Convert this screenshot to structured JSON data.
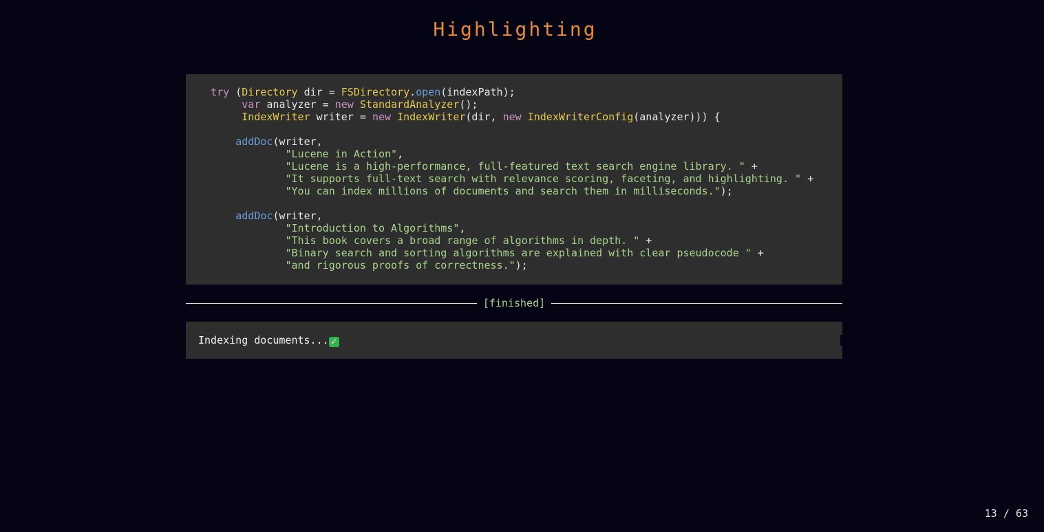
{
  "slide": {
    "title": "Highlighting",
    "page_indicator": "13 / 63"
  },
  "code": {
    "lines": [
      [
        {
          "t": "    ",
          "c": "pl"
        },
        {
          "t": "try",
          "c": "kw"
        },
        {
          "t": " (",
          "c": "pl"
        },
        {
          "t": "Directory",
          "c": "ty"
        },
        {
          "t": " dir = ",
          "c": "pl"
        },
        {
          "t": "FSDirectory",
          "c": "ty"
        },
        {
          "t": ".",
          "c": "pl"
        },
        {
          "t": "open",
          "c": "fn"
        },
        {
          "t": "(indexPath);",
          "c": "pl"
        }
      ],
      [
        {
          "t": "         ",
          "c": "pl"
        },
        {
          "t": "var",
          "c": "kw"
        },
        {
          "t": " analyzer = ",
          "c": "pl"
        },
        {
          "t": "new",
          "c": "kw"
        },
        {
          "t": " ",
          "c": "pl"
        },
        {
          "t": "StandardAnalyzer",
          "c": "ty"
        },
        {
          "t": "();",
          "c": "pl"
        }
      ],
      [
        {
          "t": "         ",
          "c": "pl"
        },
        {
          "t": "IndexWriter",
          "c": "ty"
        },
        {
          "t": " writer = ",
          "c": "pl"
        },
        {
          "t": "new",
          "c": "kw"
        },
        {
          "t": " ",
          "c": "pl"
        },
        {
          "t": "IndexWriter",
          "c": "ty"
        },
        {
          "t": "(dir, ",
          "c": "pl"
        },
        {
          "t": "new",
          "c": "kw"
        },
        {
          "t": " ",
          "c": "pl"
        },
        {
          "t": "IndexWriterConfig",
          "c": "ty"
        },
        {
          "t": "(analyzer))) {",
          "c": "pl"
        }
      ],
      [],
      [
        {
          "t": "        ",
          "c": "pl"
        },
        {
          "t": "addDoc",
          "c": "fn"
        },
        {
          "t": "(writer,",
          "c": "pl"
        }
      ],
      [
        {
          "t": "                ",
          "c": "pl"
        },
        {
          "t": "\"Lucene in Action\"",
          "c": "st"
        },
        {
          "t": ",",
          "c": "pl"
        }
      ],
      [
        {
          "t": "                ",
          "c": "pl"
        },
        {
          "t": "\"Lucene is a high-performance, full-featured text search engine library. \"",
          "c": "st"
        },
        {
          "t": " +",
          "c": "pl"
        }
      ],
      [
        {
          "t": "                ",
          "c": "pl"
        },
        {
          "t": "\"It supports full-text search with relevance scoring, faceting, and highlighting. \"",
          "c": "st"
        },
        {
          "t": " +",
          "c": "pl"
        }
      ],
      [
        {
          "t": "                ",
          "c": "pl"
        },
        {
          "t": "\"You can index millions of documents and search them in milliseconds.\"",
          "c": "st"
        },
        {
          "t": ");",
          "c": "pl"
        }
      ],
      [],
      [
        {
          "t": "        ",
          "c": "pl"
        },
        {
          "t": "addDoc",
          "c": "fn"
        },
        {
          "t": "(writer,",
          "c": "pl"
        }
      ],
      [
        {
          "t": "                ",
          "c": "pl"
        },
        {
          "t": "\"Introduction to Algorithms\"",
          "c": "st"
        },
        {
          "t": ",",
          "c": "pl"
        }
      ],
      [
        {
          "t": "                ",
          "c": "pl"
        },
        {
          "t": "\"This book covers a broad range of algorithms in depth. \"",
          "c": "st"
        },
        {
          "t": " +",
          "c": "pl"
        }
      ],
      [
        {
          "t": "                ",
          "c": "pl"
        },
        {
          "t": "\"Binary search and sorting algorithms are explained with clear pseudocode \"",
          "c": "st"
        },
        {
          "t": " +",
          "c": "pl"
        }
      ],
      [
        {
          "t": "                ",
          "c": "pl"
        },
        {
          "t": "\"and rigorous proofs of correctness.\"",
          "c": "st"
        },
        {
          "t": ");",
          "c": "pl"
        }
      ]
    ]
  },
  "status": {
    "label": "[finished]"
  },
  "output": {
    "text": "Indexing documents...",
    "check_icon": "check-mark-icon",
    "check_glyph": "✓"
  },
  "colors": {
    "background": "#050414",
    "title": "#e8883a",
    "code_background": "#2e2e2e",
    "keyword": "#c792c4",
    "type": "#e6c84f",
    "function": "#6d9cd6",
    "string": "#a8d58a"
  }
}
